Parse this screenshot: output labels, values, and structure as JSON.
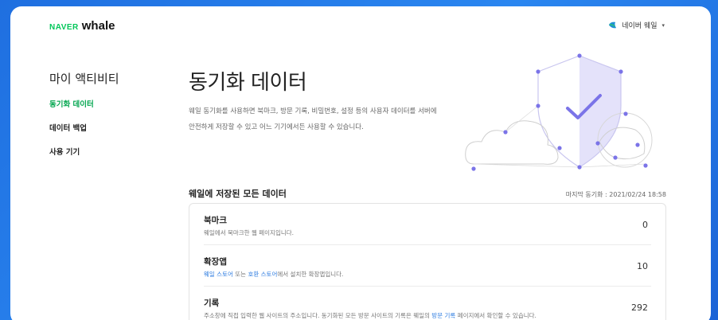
{
  "header": {
    "logo_naver": "NAVER",
    "logo_whale": "whale",
    "account_name": "네이버 웨일",
    "account_caret": "▾"
  },
  "sidebar": {
    "heading": "마이 액티비티",
    "items": [
      {
        "label": "동기화 데이터",
        "active": true
      },
      {
        "label": "데이터 백업",
        "active": false
      },
      {
        "label": "사용 기기",
        "active": false
      }
    ]
  },
  "main": {
    "title": "동기화 데이터",
    "description_line1": "웨일 동기화를 사용하면 북마크, 방문 기록, 비밀번호, 설정 등의 사용자 데이터를 서버에",
    "description_line2": "안전하게 저장할 수 있고 어느 기기에서든 사용할 수 있습니다."
  },
  "data_section": {
    "title": "웨일에 저장된 모든 데이터",
    "last_sync": "마지막 동기화 : 2021/02/24 18:58",
    "rows": [
      {
        "name": "북마크",
        "desc_pre": "웨일에서 북마크한 웹 페이지입니다.",
        "count": "0"
      },
      {
        "name": "확장앱",
        "link1": "웨일 스토어",
        "desc_mid": " 또는 ",
        "link2": "호환 스토어",
        "desc_post": "에서 설치한 확장앱입니다.",
        "count": "10"
      },
      {
        "name": "기록",
        "desc_pre": "주소창에 직접 입력한 웹 사이트의 주소입니다. 동기화된 모든 방문 사이트의 기록은 웨일의 ",
        "link1": "방문 기록",
        "desc_post": " 페이지에서 확인할 수 있습니다.",
        "count": "292"
      }
    ]
  },
  "colors": {
    "accent_green": "#03c75a",
    "link_blue": "#2f7de1",
    "illustration_purple": "#7b74e8",
    "background_blue": "#2a86f0"
  }
}
